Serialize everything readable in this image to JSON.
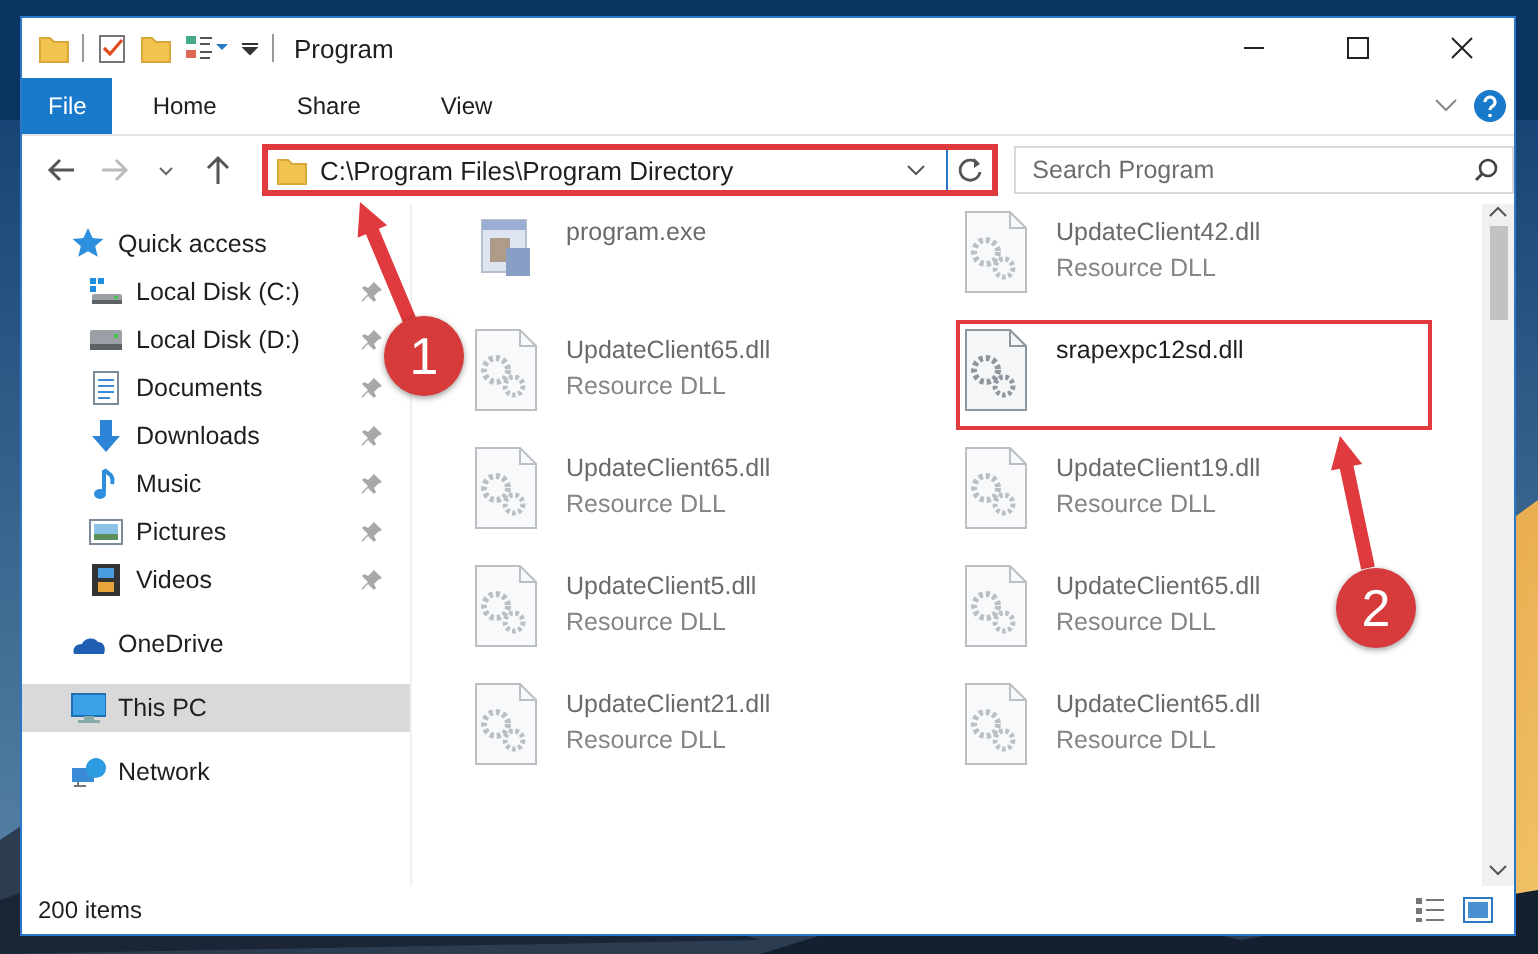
{
  "window": {
    "title": "Program"
  },
  "ribbon_tabs": [
    {
      "label": "File",
      "kind": "menu"
    },
    {
      "label": "Home",
      "kind": "tab"
    },
    {
      "label": "Share",
      "kind": "tab"
    },
    {
      "label": "View",
      "kind": "tab"
    }
  ],
  "address_bar": {
    "path": "C:\\Program Files\\Program Directory",
    "highlighted": true
  },
  "search": {
    "placeholder": "Search Program"
  },
  "navigation": [
    {
      "label": "Quick access",
      "selected": false,
      "children": [
        {
          "label": "Local Disk (C:)",
          "pinned": true,
          "selected": false
        },
        {
          "label": "Local Disk (D:)",
          "pinned": true,
          "selected": false
        },
        {
          "label": "Documents",
          "pinned": true,
          "selected": false
        },
        {
          "label": "Downloads",
          "pinned": true,
          "selected": false
        },
        {
          "label": "Music",
          "pinned": true,
          "selected": false
        },
        {
          "label": "Pictures",
          "pinned": true,
          "selected": false
        },
        {
          "label": "Videos",
          "pinned": true,
          "selected": false
        }
      ]
    },
    {
      "label": "OneDrive",
      "selected": false
    },
    {
      "label": "This PC",
      "selected": true
    },
    {
      "label": "Network",
      "selected": false
    }
  ],
  "files": [
    {
      "name": "program.exe",
      "kind": "exe",
      "blurred": true,
      "highlighted": false
    },
    {
      "name": "UpdateClient42.dll",
      "type": "Resource DLL",
      "kind": "dll",
      "blurred": true,
      "highlighted": false
    },
    {
      "name": "UpdateClient65.dll",
      "type": "Resource DLL",
      "kind": "dll",
      "blurred": true,
      "highlighted": false
    },
    {
      "name": "srapexpc12sd.dll",
      "kind": "dll",
      "blurred": false,
      "highlighted": true
    },
    {
      "name": "UpdateClient65.dll",
      "type": "Resource DLL",
      "kind": "dll",
      "blurred": true,
      "highlighted": false
    },
    {
      "name": "UpdateClient19.dll",
      "type": "Resource DLL",
      "kind": "dll",
      "blurred": true,
      "highlighted": false
    },
    {
      "name": "UpdateClient5.dll",
      "type": "Resource DLL",
      "kind": "dll",
      "blurred": true,
      "highlighted": false
    },
    {
      "name": "UpdateClient65.dll",
      "type": "Resource DLL",
      "kind": "dll",
      "blurred": true,
      "highlighted": false
    },
    {
      "name": "UpdateClient21.dll",
      "type": "Resource DLL",
      "kind": "dll",
      "blurred": true,
      "highlighted": false
    },
    {
      "name": "UpdateClient65.dll",
      "type": "Resource DLL",
      "kind": "dll",
      "blurred": true,
      "highlighted": false
    }
  ],
  "annotations": [
    {
      "label": "1"
    },
    {
      "label": "2"
    }
  ],
  "status_bar": {
    "item_count": "200 items"
  }
}
